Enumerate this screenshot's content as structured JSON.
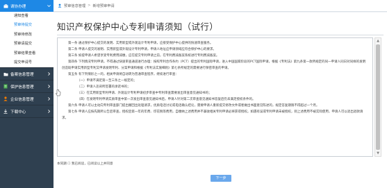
{
  "sidebar": {
    "menus": [
      {
        "label": "请协办理",
        "icon": "briefcase-icon",
        "active": true,
        "expanded": true,
        "items": [
          {
            "label": "通知查看"
          },
          {
            "label": "预审待提交",
            "active": true
          },
          {
            "label": "预审待修改"
          },
          {
            "label": "预审请提交"
          },
          {
            "label": "预审结果查看"
          },
          {
            "label": "提交申请号"
          }
        ]
      },
      {
        "label": "备案信息管理",
        "icon": "folder-icon"
      },
      {
        "label": "保护信息管理",
        "icon": "doc-icon"
      },
      {
        "label": "企业信息管理",
        "icon": "user-icon"
      },
      {
        "label": "下载中心",
        "icon": "download-icon"
      }
    ]
  },
  "topbar": {
    "crumb1": "预审信息管理",
    "crumb2": "新增预审申请"
  },
  "main": {
    "title": "知识产权保护中心专利申请须知（试行）",
    "paragraphs": [
      "第一条 通过保护中心提交的发明、实用新型或外观设计专利申请，应接受保护中心提供的快速审查服务。",
      "第二条 申请人提交的发明、实用新型或外观设计专利申请，申请人地址应申请领域应符合保护中心的要求。",
      "第三条 如提申请人希望享受专利费用减缴，应在提交专利申请之前，在专利费减备案系统进行专利费减备案。",
      "第四条 下列情况专利申请，不得通过快速审查通道进行办理：按照专利合作条约（PCT）提出的专利国际申请，进入中国国家阶段的PCT国际申请，根据《专利法》第九条第一款所规定的同一申请人同日对同样的发明创造既申请实用新型专利又申请发明专利、分案申请和根据《专利法实施细则》第七条所规定的需要进行保密审查的申请。",
      "第五条 有下列情形之一的，相关申请将自动转为普通审查程序，继续进行审查：",
      "（一）申请不满足第一至三条之一规定的；",
      "（二）申请人违背所签署的承诺书的；",
      "（三）在实用新型专利申请、外观设计专利申请初步审查中专利审查需要发出审查意见通知书的；",
      "（四）在发明专利申请实质审查中第一次发出审查意见通知书后，申请人针对第二次审查意见通知书答复后仍未满足授权条件的。",
      "第六条 申请人可以主动向专利审查部门提出撤回出处理请求，优质电话讨论或电话确认结论，需要申请人重新提交修改文件或者做出书面意见陈述的，规定答复期限不得超过一个月。",
      "第七条 申请人应按先期所公告后审查，授权后第一年的年费、印花税等费用，自缴纳上述费用并不兼收相关专利申请必将获得授权。如遇有误或专利申请未被授权，则上述费用不被实际使用，申请人可以退出退款请求。"
    ],
    "agree_label": "本同期 ☐ 我已阅读，已阅读以上并同意",
    "next_button": "下一步"
  }
}
